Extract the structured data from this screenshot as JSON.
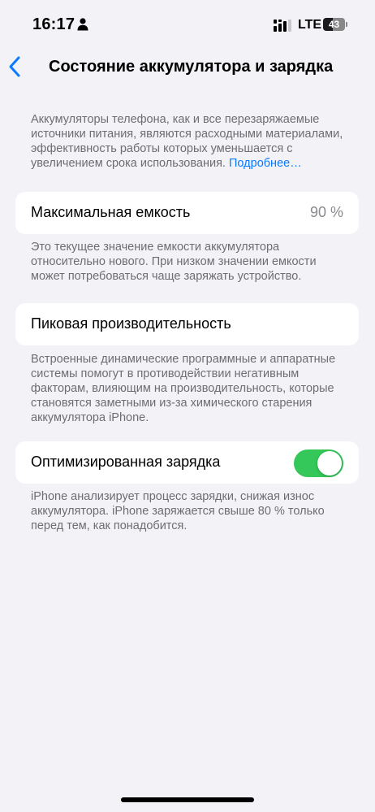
{
  "status_bar": {
    "time": "16:17",
    "network": "LTE",
    "battery_level": "43",
    "battery_fraction": 0.43
  },
  "nav": {
    "back_icon": "chevron-left-icon",
    "title": "Состояние аккумулятора и зарядка"
  },
  "intro": {
    "text": "Аккумуляторы телефона, как и все перезаряжаемые источники питания, являются расходными материа­лами, эффективность работы которых уменьшается с увеличением срока использования. ",
    "link": "Подробнее…"
  },
  "max_capacity": {
    "label": "Максимальная емкость",
    "value": "90 %",
    "note": "Это текущее значение емкости аккумулятора относительно нового. При низком значении емкости может потребоваться чаще заряжать устройство."
  },
  "peak_performance": {
    "label": "Пиковая производительность",
    "note": "Встроенные динамические программные и аппарат­ные системы помогут в противодействии негативным факторам, влияющим на производительность, которые становятся заметными из-за химического старения аккумулятора iPhone."
  },
  "optimized_charging": {
    "label": "Оптимизированная зарядка",
    "enabled": true,
    "note": "iPhone анализирует процесс зарядки, снижая износ аккумулятора. iPhone заряжается свыше 80 % только перед тем, как понадобится."
  },
  "colors": {
    "accent": "#0a7aff",
    "toggle_on": "#34c759",
    "background": "#f2f2f7"
  }
}
